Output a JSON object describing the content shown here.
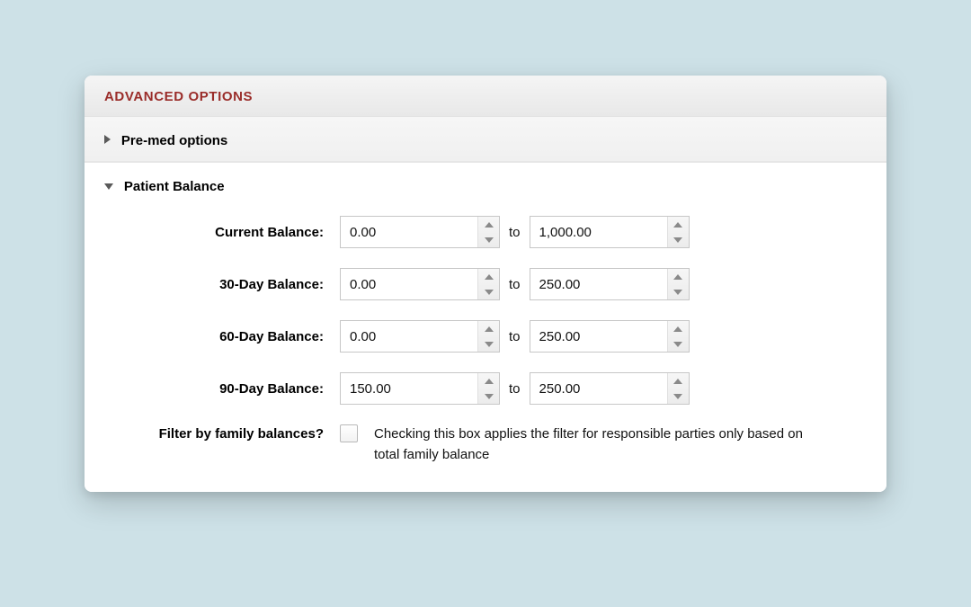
{
  "panel": {
    "title": "ADVANCED OPTIONS"
  },
  "sections": {
    "pre_med": {
      "title": "Pre-med options",
      "expanded": false
    },
    "patient_balance": {
      "title": "Patient Balance",
      "expanded": true,
      "rows": {
        "current": {
          "label": "Current Balance:",
          "from": "0.00",
          "to": "1,000.00"
        },
        "d30": {
          "label": "30-Day Balance:",
          "from": "0.00",
          "to": "250.00"
        },
        "d60": {
          "label": "60-Day Balance:",
          "from": "0.00",
          "to": "250.00"
        },
        "d90": {
          "label": "90-Day Balance:",
          "from": "150.00",
          "to": "250.00"
        }
      },
      "separator": "to",
      "filter_family": {
        "label": "Filter by family balances?",
        "checked": false,
        "description": "Checking this box applies the filter for responsible parties only based on total family balance"
      }
    }
  }
}
